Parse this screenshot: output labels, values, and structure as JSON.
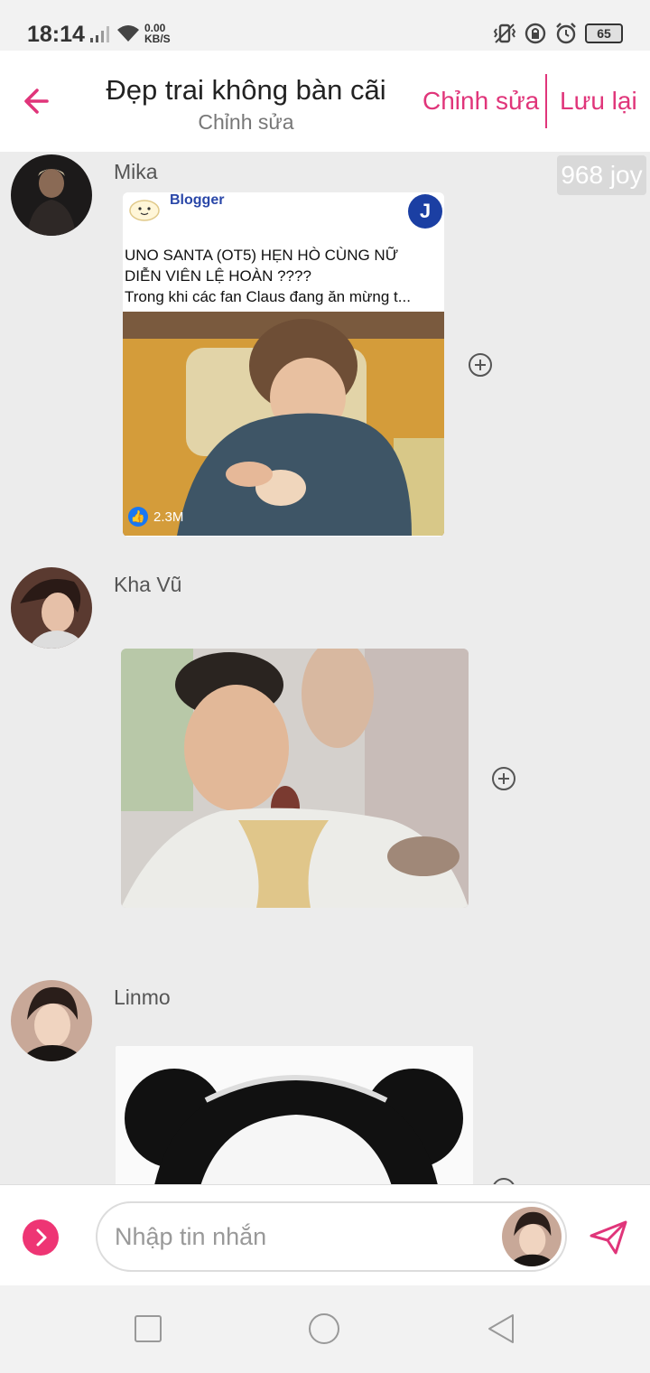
{
  "status_bar": {
    "time": "18:14",
    "net_speed_value": "0.00",
    "net_speed_unit": "KB/S",
    "battery": "65"
  },
  "header": {
    "title": "Đẹp trai không bàn cãi",
    "subtitle": "Chỉnh sửa",
    "edit_label": "Chỉnh sửa",
    "save_label": "Lưu lại"
  },
  "chat": {
    "joy_badge": "968 joy",
    "messages": [
      {
        "sender": "Mika",
        "type": "link-card",
        "card": {
          "source": "Blogger",
          "source_badge": "J",
          "headline_line1": "UNO SANTA (OT5) HẸN HÒ CÙNG NỮ",
          "headline_line2": "DIỄN VIÊN LỆ HOÀN ????",
          "headline_line3": "Trong khi các fan Claus đang ăn mừng t...",
          "likes": "2.3M"
        }
      },
      {
        "sender": "Kha Vũ",
        "type": "image"
      },
      {
        "sender": "Linmo",
        "type": "image"
      }
    ]
  },
  "composer": {
    "placeholder": "Nhập tin nhắn"
  },
  "colors": {
    "accent": "#e0357a",
    "more_button": "#ee3574",
    "chat_background": "#ececec"
  },
  "icons": [
    "back-arrow-icon",
    "add-circle-icon",
    "chevron-right-icon",
    "send-icon",
    "nav-square-icon",
    "nav-circle-icon",
    "nav-back-icon"
  ]
}
